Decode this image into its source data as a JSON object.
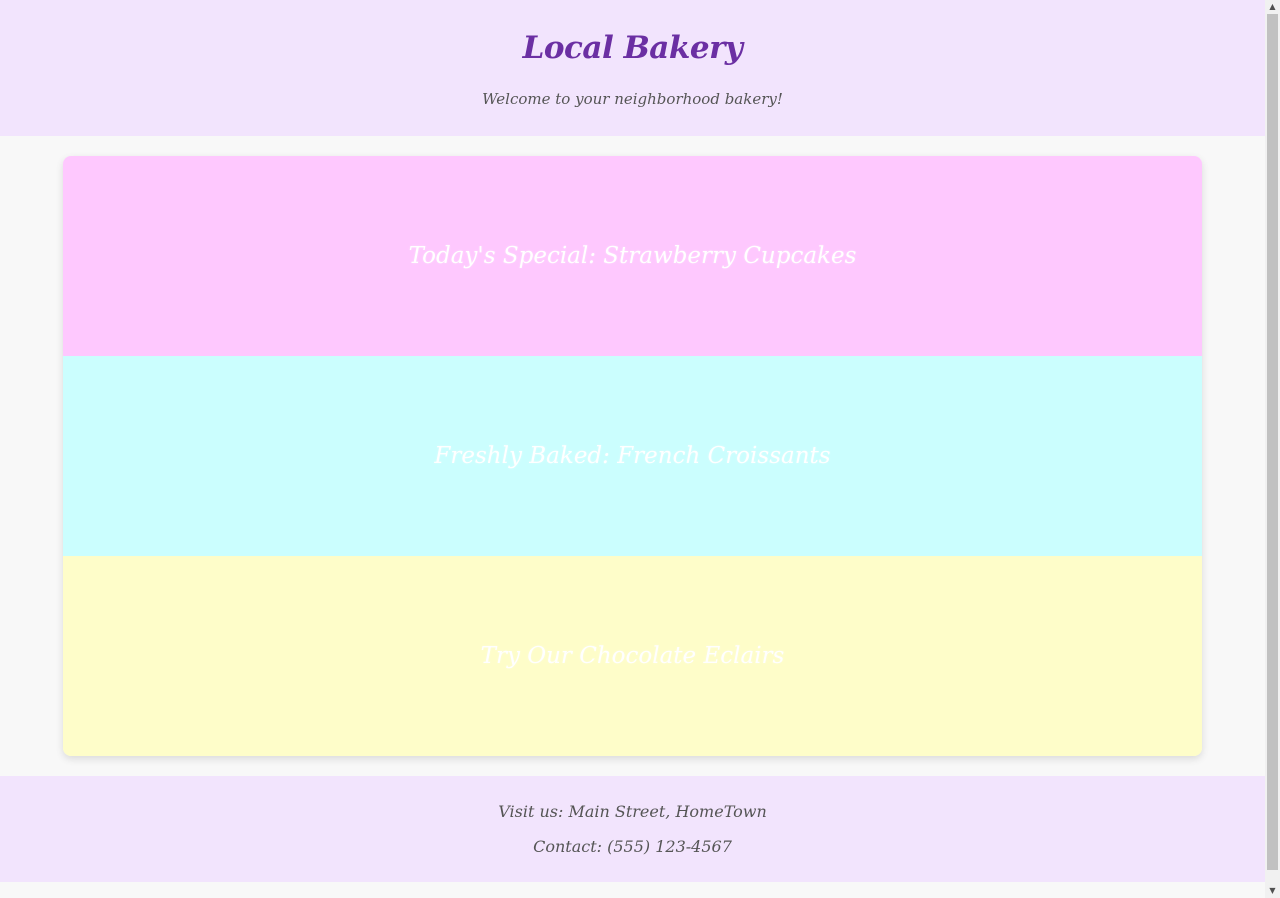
{
  "header": {
    "title": "Local Bakery",
    "tagline": "Welcome to your neighborhood bakery!"
  },
  "slides": [
    {
      "label": "Today's Special: Strawberry Cupcakes",
      "color": "#fec8fe"
    },
    {
      "label": "Freshly Baked: French Croissants",
      "color": "#cbfefe"
    },
    {
      "label": "Try Our Chocolate Eclairs",
      "color": "#fefdc9"
    }
  ],
  "footer": {
    "address": "Visit us: Main Street, HomeTown",
    "contact": "Contact: (555) 123-4567"
  },
  "colors": {
    "header_bg": "#f2e4fd",
    "title": "#6b2fa3",
    "page_bg": "#f8f8f8"
  },
  "scrollbar": {
    "up_icon": "triangle-up",
    "down_icon": "triangle-down"
  }
}
